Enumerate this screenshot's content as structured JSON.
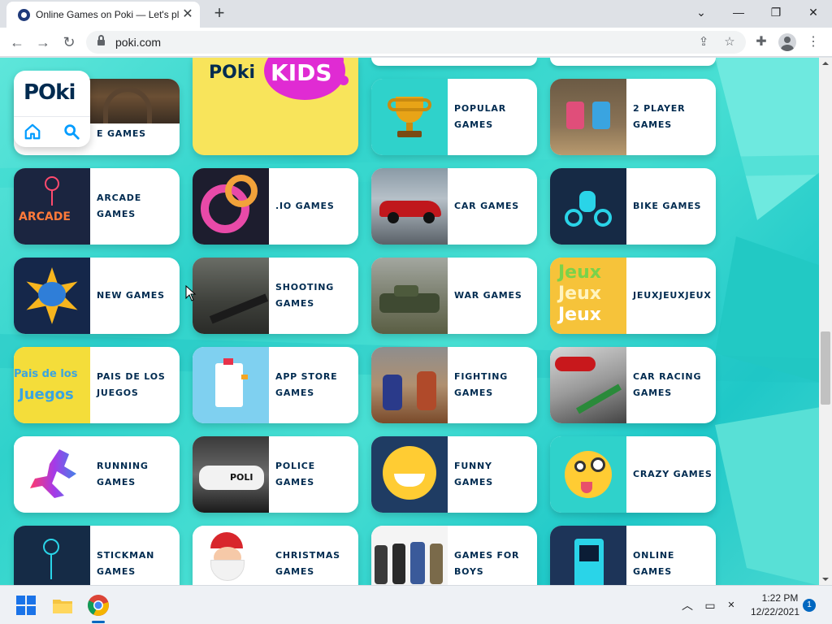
{
  "browser": {
    "tab_title": "Online Games on Poki — Let's pl",
    "url": "poki.com",
    "icons": {
      "tab_close": "✕",
      "new_tab": "+",
      "minimize": "—",
      "maximize": "❐",
      "close": "✕",
      "tab_list": "⌄",
      "back": "←",
      "forward": "→",
      "reload": "↻",
      "share": "⇪",
      "bookmark": "☆",
      "extensions": "✚",
      "menu": "⋮"
    }
  },
  "poki_panel": {
    "logo_text": "POki"
  },
  "kids_banner": {
    "logo_left": "POki",
    "logo_right": "KIDS"
  },
  "games": [
    {
      "label": "E GAMES",
      "thumb": "ruins"
    },
    {
      "label": "POPULAR GAMES",
      "thumb": "trophy"
    },
    {
      "label": "2 PLAYER GAMES",
      "thumb": "two-player"
    },
    {
      "label": "ARCADE GAMES",
      "thumb": "arcade"
    },
    {
      "label": ".IO GAMES",
      "thumb": "io"
    },
    {
      "label": "CAR GAMES",
      "thumb": "car"
    },
    {
      "label": "BIKE GAMES",
      "thumb": "bike"
    },
    {
      "label": "NEW GAMES",
      "thumb": "new"
    },
    {
      "label": "SHOOTING GAMES",
      "thumb": "shooting"
    },
    {
      "label": "WAR GAMES",
      "thumb": "war"
    },
    {
      "label": "JEUXJEUXJEUX",
      "thumb": "jeux"
    },
    {
      "label": "PAIS DE LOS JUEGOS",
      "thumb": "pais"
    },
    {
      "label": "APP STORE GAMES",
      "thumb": "appstore"
    },
    {
      "label": "FIGHTING GAMES",
      "thumb": "fighting"
    },
    {
      "label": "CAR RACING GAMES",
      "thumb": "racing"
    },
    {
      "label": "RUNNING GAMES",
      "thumb": "running"
    },
    {
      "label": "POLICE GAMES",
      "thumb": "police"
    },
    {
      "label": "FUNNY GAMES",
      "thumb": "funny"
    },
    {
      "label": "CRAZY GAMES",
      "thumb": "crazy"
    },
    {
      "label": "STICKMAN GAMES",
      "thumb": "stickman"
    },
    {
      "label": "CHRISTMAS GAMES",
      "thumb": "christmas"
    },
    {
      "label": "GAMES FOR BOYS",
      "thumb": "boys"
    },
    {
      "label": "ONLINE GAMES",
      "thumb": "online"
    }
  ],
  "thumb_text": {
    "arcade": "ARCADE",
    "jeux": [
      "Jeux",
      "Jeux",
      "Jeux"
    ],
    "pais": [
      "Pais de los",
      "Juegos"
    ],
    "police": "POLI"
  },
  "colors": {
    "background": "#2fd2cb",
    "label_text": "#002b50",
    "kids_yellow": "#f8e45b",
    "kids_pink": "#e02bd3",
    "accent_blue": "#009cff"
  },
  "taskbar": {
    "time": "1:22 PM",
    "date": "12/22/2021",
    "notification_count": "1",
    "icons": {
      "chevron_up": "︿",
      "network": "▭",
      "volume": "✕"
    }
  }
}
